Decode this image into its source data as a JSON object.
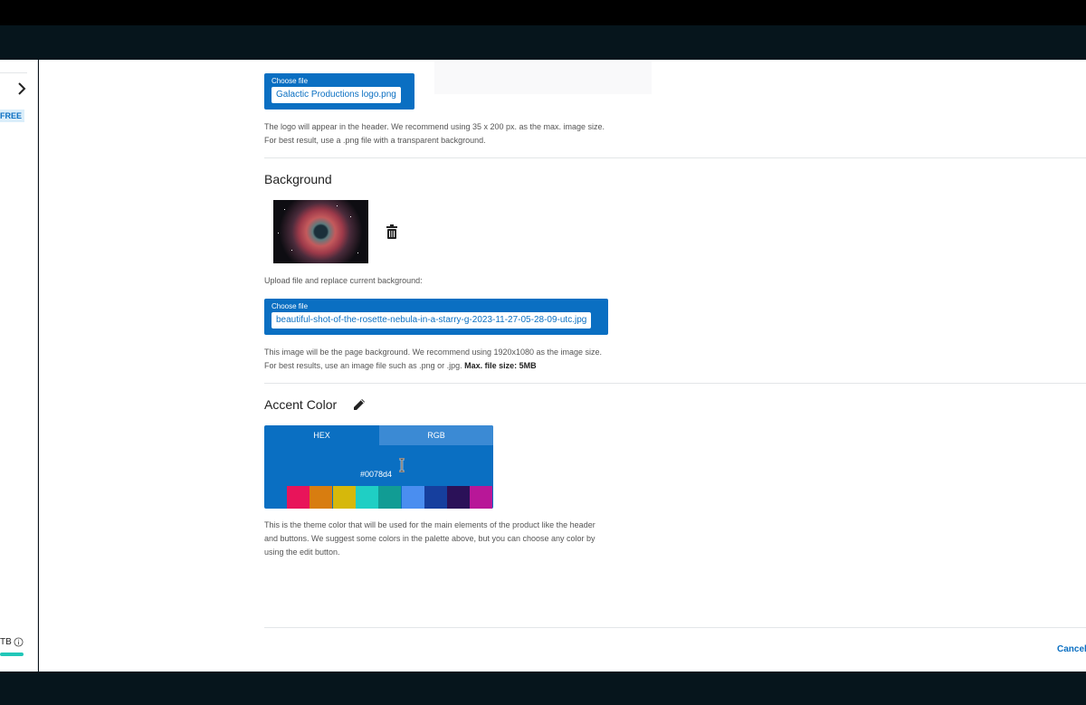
{
  "sidebar": {
    "badge": "FREE",
    "storage_label": "TB",
    "icons": {
      "expand": "chevron-right-icon",
      "info": "info-icon"
    },
    "colors": {
      "badge_bg": "#dbeefa",
      "badge_text": "#0a6fc2",
      "storage_bar": "#21c7b8"
    }
  },
  "logo": {
    "choose_label": "Choose file",
    "filename": "Galactic Productions logo.png",
    "note_line1": "The logo will appear in the header. We recommend using 35 x 200 px. as the max. image size.",
    "note_line2": "For best result, use a .png file with a transparent background."
  },
  "background": {
    "title": "Background",
    "upload_label": "Upload file and replace current background:",
    "choose_label": "Choose file",
    "filename": "beautiful-shot-of-the-rosette-nebula-in-a-starry-g-2023-11-27-05-28-09-utc.jpg",
    "note_line1": "This image will be the page background. We recommend using 1920x1080 as the image size.",
    "note_line2": "For best results, use an image file such as .png or .jpg.",
    "note_bold": "Max. file size: 5MB",
    "icons": {
      "delete": "trash-icon"
    }
  },
  "accent": {
    "title": "Accent Color",
    "tabs": [
      "HEX",
      "RGB"
    ],
    "active_tab": "HEX",
    "hex_value": "#0078d4",
    "swatches": [
      "#e8145a",
      "#d87d10",
      "#d6b80b",
      "#1fcfc4",
      "#119c94",
      "#4a8ef0",
      "#163f9e",
      "#2b1158",
      "#b81798"
    ],
    "note_line1": "This is the theme color that will be used for the main elements of the product like the header",
    "note_line2": "and buttons. We suggest some colors in the palette above, but you can choose any color by",
    "note_line3": "using the edit button.",
    "icons": {
      "edit": "pencil-icon"
    }
  },
  "footer": {
    "cancel_label": "Cancel"
  },
  "colors": {
    "primary": "#0a6fc2",
    "tab_inactive": "#3b8ad4"
  }
}
